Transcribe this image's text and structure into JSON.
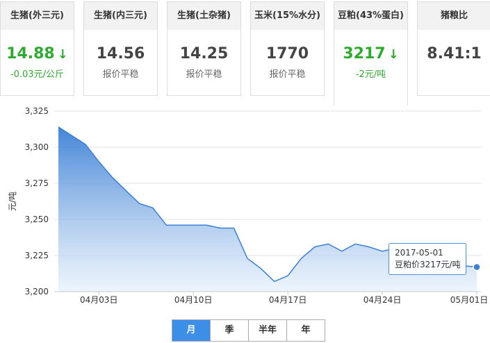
{
  "cards": [
    {
      "title": "生猪(外三元)",
      "value": "14.88",
      "arrow": "down-arrow-icon",
      "sub": "-0.03元/公斤",
      "trend": "down",
      "active": false
    },
    {
      "title": "生猪(内三元)",
      "value": "14.56",
      "arrow": "",
      "sub": "报价平稳",
      "trend": "flat",
      "active": false
    },
    {
      "title": "生猪(土杂猪)",
      "value": "14.25",
      "arrow": "",
      "sub": "报价平稳",
      "trend": "flat",
      "active": false
    },
    {
      "title": "玉米(15%水分)",
      "value": "1770",
      "arrow": "",
      "sub": "报价平稳",
      "trend": "flat",
      "active": false
    },
    {
      "title": "豆粕(43%蛋白)",
      "value": "3217",
      "arrow": "down-arrow-icon",
      "sub": "-2元/吨",
      "trend": "down",
      "active": true
    },
    {
      "title": "猪粮比",
      "value": "8.41:1",
      "arrow": "",
      "sub": "",
      "trend": "flat",
      "active": false
    }
  ],
  "colors": {
    "down": "#2eaa2e",
    "line": "#3a7fd5",
    "accent": "#3c8ee6"
  },
  "tabs": [
    {
      "label": "月",
      "active": true
    },
    {
      "label": "季",
      "active": false
    },
    {
      "label": "半年",
      "active": false
    },
    {
      "label": "年",
      "active": false
    }
  ],
  "tooltip": {
    "date": "2017-05-01",
    "text": "豆粕价3217元/吨"
  },
  "chart_data": {
    "type": "area",
    "ylabel": "元/吨",
    "ylim": [
      3200,
      3325
    ],
    "yticks": [
      3200,
      3225,
      3250,
      3275,
      3300,
      3325
    ],
    "ytick_labels": [
      "3,200",
      "3,225",
      "3,250",
      "3,275",
      "3,300",
      "3,325"
    ],
    "xlim": [
      "2017-03-31",
      "2017-05-01"
    ],
    "xticks": [
      "2017-04-03",
      "2017-04-10",
      "2017-04-17",
      "2017-04-24",
      "2017-05-01"
    ],
    "xtick_labels": [
      "04月03日",
      "04月10日",
      "04月17日",
      "04月24日",
      "05月01日"
    ],
    "grid": true,
    "series": [
      {
        "x": [
          "2017-03-31",
          "2017-04-01",
          "2017-04-02",
          "2017-04-03",
          "2017-04-04",
          "2017-04-05",
          "2017-04-06",
          "2017-04-07",
          "2017-04-08",
          "2017-04-09",
          "2017-04-10",
          "2017-04-11",
          "2017-04-12",
          "2017-04-13",
          "2017-04-14",
          "2017-04-15",
          "2017-04-16",
          "2017-04-17",
          "2017-04-18",
          "2017-04-19",
          "2017-04-20",
          "2017-04-21",
          "2017-04-22",
          "2017-04-23",
          "2017-04-24",
          "2017-04-25",
          "2017-04-26",
          "2017-04-27",
          "2017-04-28",
          "2017-04-29",
          "2017-04-30",
          "2017-05-01"
        ],
        "y": [
          3314,
          3308,
          3302,
          3290,
          3279,
          3270,
          3261,
          3258,
          3246,
          3246,
          3246,
          3246,
          3244,
          3244,
          3223,
          3216,
          3207,
          3211,
          3223,
          3231,
          3233,
          3228,
          3233,
          3231,
          3228,
          3230,
          3226,
          3225,
          3220,
          3219,
          3218,
          3217
        ]
      }
    ],
    "highlight": {
      "x": "2017-05-01",
      "y": 3217
    }
  }
}
